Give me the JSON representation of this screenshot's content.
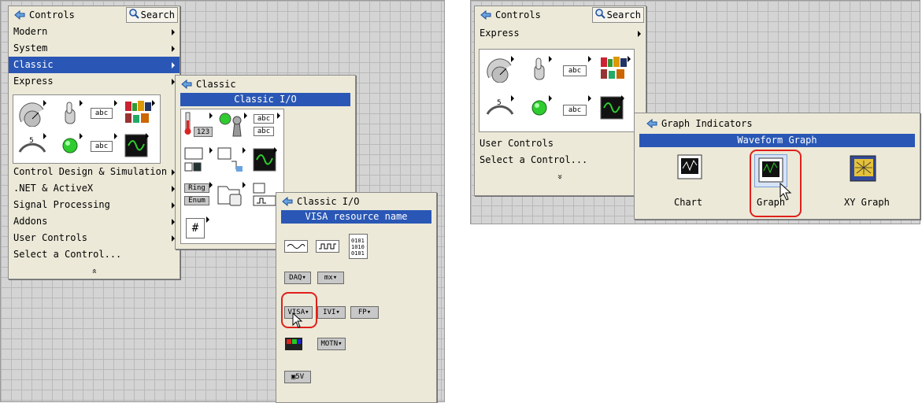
{
  "left": {
    "controls_title": "Controls",
    "search_label": "Search",
    "menu_top": [
      {
        "label": "Modern",
        "arrow": true
      },
      {
        "label": "System",
        "arrow": true
      },
      {
        "label": "Classic",
        "arrow": true,
        "selected": true
      },
      {
        "label": "Express",
        "arrow": true
      }
    ],
    "menu_bottom": [
      {
        "label": "Control Design & Simulation",
        "arrow": true
      },
      {
        "label": ".NET & ActiveX",
        "arrow": true
      },
      {
        "label": "Signal Processing",
        "arrow": true
      },
      {
        "label": "Addons",
        "arrow": true
      },
      {
        "label": "User Controls",
        "arrow": true
      },
      {
        "label": "Select a Control...",
        "arrow": false
      }
    ],
    "chevron": "»",
    "classic_panel": {
      "title": "Classic",
      "header": "Classic I/O",
      "tiles": [
        "123",
        "abc",
        "abc",
        "Ring",
        "Enum",
        "#"
      ]
    },
    "classic_io_panel": {
      "title": "Classic I/O",
      "header": "VISA resource name",
      "buttons": [
        "DAQ",
        "mx",
        "VISA",
        "IVI",
        "FP",
        "MOTN",
        "5V"
      ]
    }
  },
  "right": {
    "controls_title": "Controls",
    "search_label": "Search",
    "express_label": "Express",
    "menu_items": [
      {
        "label": "User Controls"
      },
      {
        "label": "Select a Control..."
      }
    ],
    "chevron": "»",
    "graph_panel": {
      "title": "Graph Indicators",
      "header": "Waveform Graph",
      "items": [
        {
          "label": "Chart"
        },
        {
          "label": "Graph"
        },
        {
          "label": "XY Graph"
        }
      ]
    }
  },
  "palette_tiles": {
    "abc": "abc"
  },
  "colors": {
    "selection": "#2a57b5",
    "panel_bg": "#ece9d8",
    "highlight": "#e0201c"
  }
}
